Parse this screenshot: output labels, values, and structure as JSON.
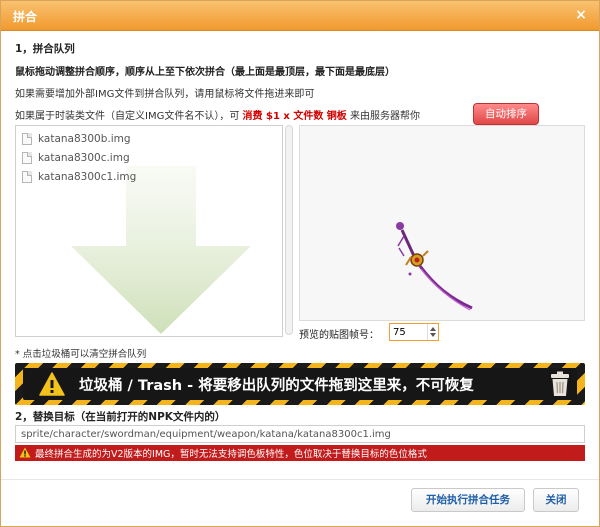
{
  "dialog": {
    "title": "拼合",
    "close_glyph": "×"
  },
  "section1": {
    "title": "1，拼合队列",
    "instruction_bold": "鼠标拖动调整拼合顺序，顺序从上至下依次拼合（最上面是最顶层，最下面是最底层）",
    "instruction_add": "如果需要增加外部IMG文件到拼合队列，请用鼠标将文件拖进来即可",
    "fashion_prefix": "如果属于时装类文件（自定义IMG文件名不认），可",
    "fashion_price": "消费 $1 x 文件数 铜板",
    "fashion_suffix": "来由服务器帮你",
    "auto_sort_label": "自动排序"
  },
  "queue": {
    "items": [
      {
        "name": "katana8300b.img"
      },
      {
        "name": "katana8300c.img"
      },
      {
        "name": "katana8300c1.img"
      }
    ]
  },
  "preview": {
    "frame_label": "预览的贴图帧号：",
    "frame_value": "75"
  },
  "hint": "* 点击垃圾桶可以清空拼合队列",
  "trash": {
    "text": "垃圾桶 / Trash  - 将要移出队列的文件拖到这里来，不可恢复"
  },
  "section2": {
    "title": "2，替换目标（在当前打开的NPK文件内的）",
    "target_path": "sprite/character/swordman/equipment/weapon/katana/katana8300c1.img",
    "warning": "最终拼合生成的为V2版本的IMG，暂时无法支持调色板特性，色位取决于替换目标的色位格式"
  },
  "footer": {
    "start_label": "开始执行拼合任务",
    "close_label": "关闭"
  },
  "colors": {
    "title_bar": "#f19a2f",
    "auto_sort": "#e04848",
    "price_text": "#d40000",
    "warning_bg": "#c21b1b",
    "button_text": "#1f5fa8"
  },
  "icons": {
    "close": "close-icon",
    "file": "file-icon",
    "drop_arrow": "down-arrow-icon",
    "warning": "warning-triangle-icon",
    "trash": "trash-can-icon",
    "spinner": "spinner-arrows-icon"
  }
}
